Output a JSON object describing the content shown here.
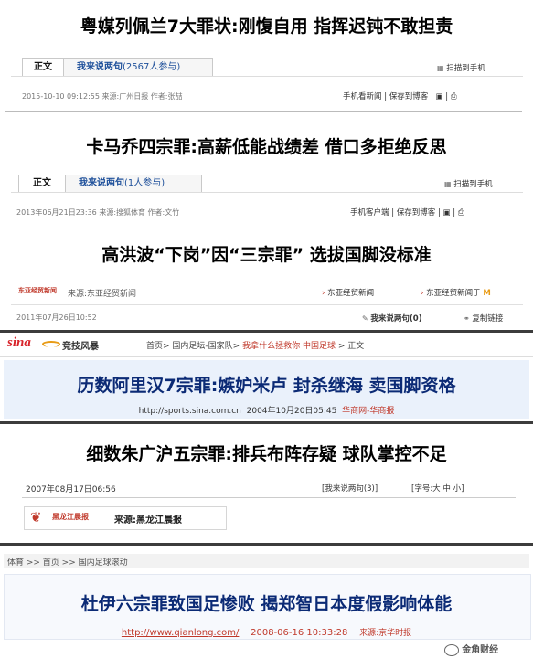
{
  "panels": [
    {
      "headline": "粤媒列佩兰7大罪状:刚愎自用  指挥迟钝不敢担责",
      "tab_main": "正文",
      "tab_comment_label": "我来说两句",
      "tab_comment_count": "(2567人参与)",
      "qr_label": "扫描到手机",
      "meta": "2015-10-10 09:12:55   来源:广州日报  作者:张喆",
      "right_links": "手机看新闻 | 保存到博客 | ▣ | ⎙"
    },
    {
      "headline": "卡马乔四宗罪:高薪低能战绩差  借口多拒绝反思",
      "tab_main": "正文",
      "tab_comment_label": "我来说两句",
      "tab_comment_count": "(1人参与)",
      "qr_label": "扫描到手机",
      "meta": "2013年06月21日23:36   来源:搜狐体育  作者:文竹",
      "right_links": "手机客户端 | 保存到博客 | ▣ | ⎙"
    },
    {
      "headline": "高洪波“下岗”因“三宗罪”  选拔国脚没标准",
      "source_logo": "东亚经贸新闻",
      "source": "来源:东亚经贸新闻",
      "right_a": "东亚经贸新闻",
      "right_b": "东亚经贸新闻于",
      "date": "2011年07月26日10:52",
      "comment_link": "我来说两句(0)",
      "copy_link": "复制链接"
    },
    {
      "logo": "sina",
      "channel": "竞技风暴",
      "crumb": "首页> 国内足坛-国家队>",
      "crumb_red": "我拿什么拯救你 中国足球",
      "crumb_end": "> 正文",
      "headline": "历数阿里汉7宗罪:嫉妒米卢  封杀继海  卖国脚资格",
      "url": "http://sports.sina.com.cn",
      "date": "2004年10月20日05:45",
      "source": "华商网-华商报"
    },
    {
      "headline": "细数朱广沪五宗罪:排兵布阵存疑  球队掌控不足",
      "date": "2007年08月17日06:56",
      "comment": "[我来说两句(3)]",
      "font_size": "[字号:大 中 小]",
      "logo_text": "黑龙江晨报",
      "source": "来源:黑龙江晨报"
    },
    {
      "crumb": "体育 >> 首页 >> 国内足球滚动",
      "headline": "杜伊六宗罪致国足惨败  揭郑智日本度假影响体能",
      "url": "http://www.qianlong.com/",
      "date": "2008-06-16 10:33:28",
      "source": "来源:京华时报",
      "watermark": "金角财经"
    }
  ]
}
